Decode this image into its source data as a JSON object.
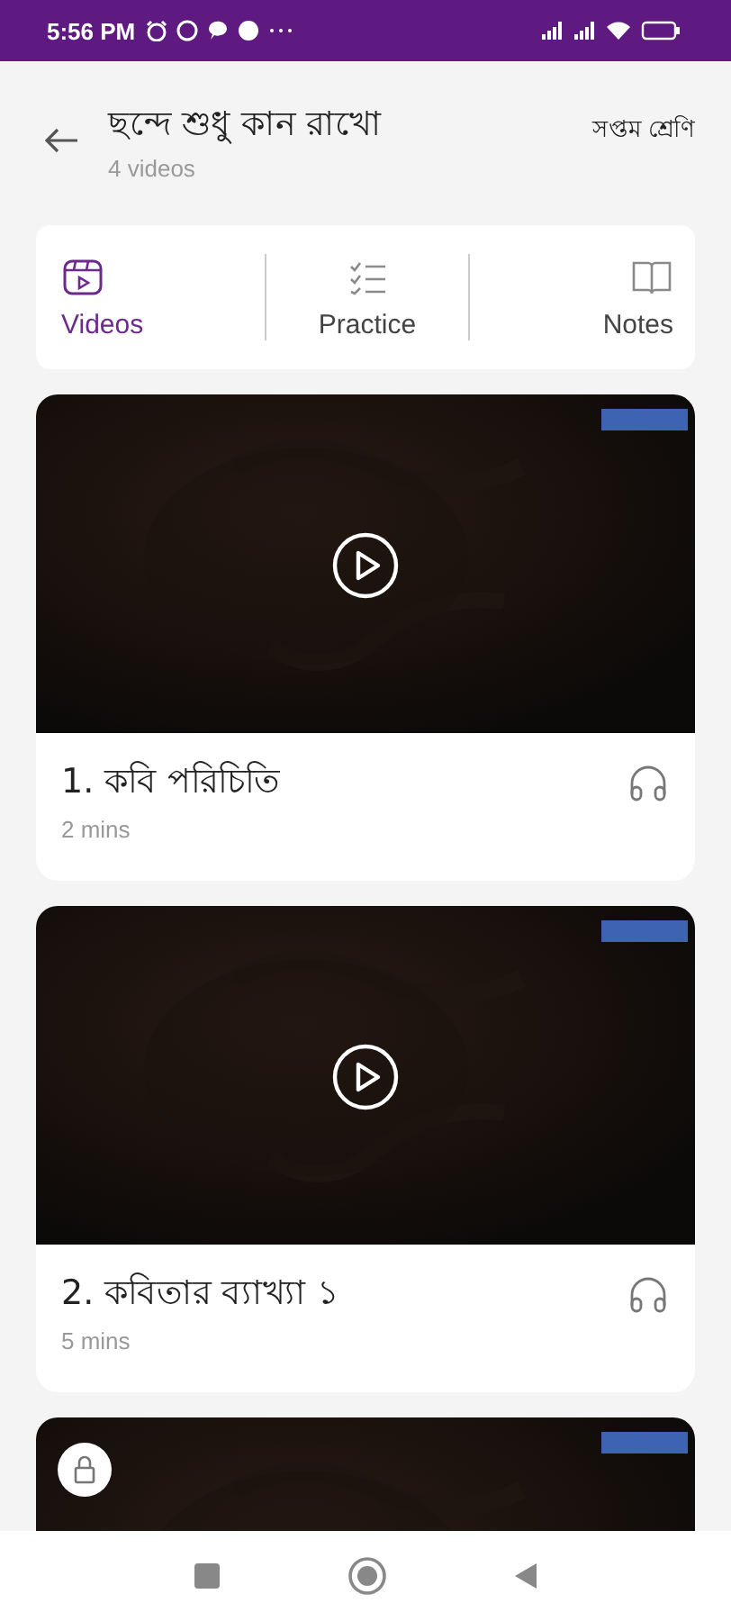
{
  "status_bar": {
    "time": "5:56 PM"
  },
  "header": {
    "title": "ছন্দে শুধু কান রাখো",
    "subtitle": "4 videos",
    "grade": "সপ্তম শ্রেণি"
  },
  "tabs": [
    {
      "label": "Videos",
      "kind": "videos",
      "selected": true
    },
    {
      "label": "Practice",
      "kind": "practice",
      "selected": false
    },
    {
      "label": "Notes",
      "kind": "notes",
      "selected": false
    }
  ],
  "videos": [
    {
      "title": "1. কবি পরিচিতি",
      "duration": "2 mins",
      "locked": false
    },
    {
      "title": "2. কবিতার ব্যাখ্যা ১",
      "duration": "5 mins",
      "locked": false
    },
    {
      "locked": true
    }
  ]
}
